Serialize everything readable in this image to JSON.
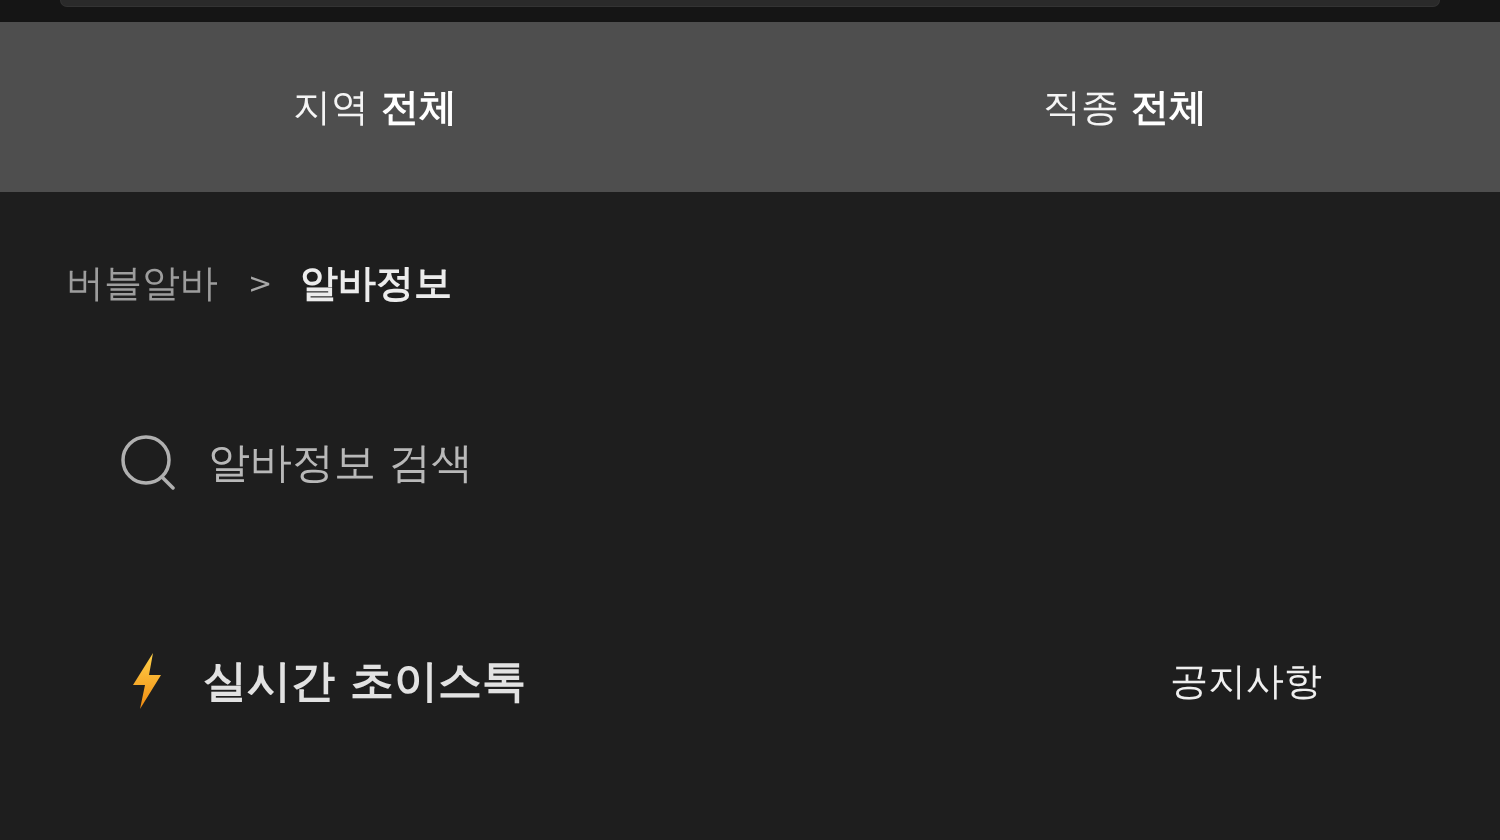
{
  "filters": [
    {
      "label": "지역",
      "value": "전체"
    },
    {
      "label": "직종",
      "value": "전체"
    }
  ],
  "breadcrumb": {
    "separator": ">",
    "items": [
      {
        "label": "버블알바",
        "current": false
      },
      {
        "label": "알바정보",
        "current": true
      }
    ]
  },
  "search": {
    "placeholder": "알바정보 검색"
  },
  "section": {
    "title": "실시간 초이스톡",
    "link": "공지사항"
  }
}
